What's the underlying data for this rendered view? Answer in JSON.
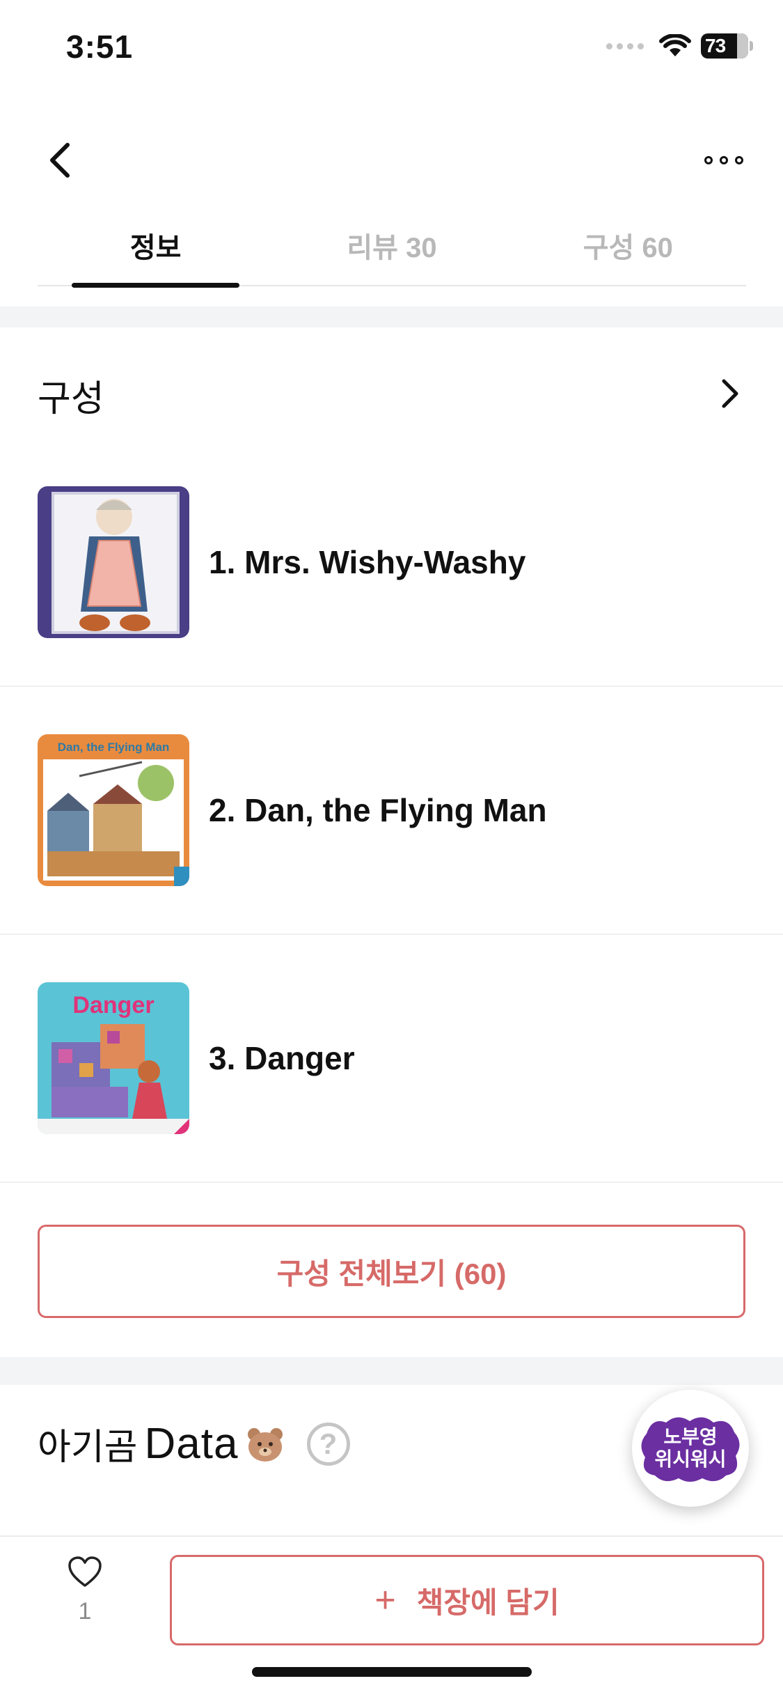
{
  "status_bar": {
    "time": "3:51",
    "battery": "73"
  },
  "nav": {
    "back": "back",
    "more": "more"
  },
  "tabs": [
    {
      "label": "정보",
      "active": true
    },
    {
      "label": "리뷰 30",
      "active": false
    },
    {
      "label": "구성 60",
      "active": false
    }
  ],
  "section": {
    "title": "구성"
  },
  "books": [
    {
      "title": "1. Mrs. Wishy-Washy",
      "cover_text": ""
    },
    {
      "title": "2. Dan, the Flying Man",
      "cover_text": "Dan, the Flying Man"
    },
    {
      "title": "3. Danger",
      "cover_text": "Danger"
    }
  ],
  "view_all_label": "구성 전체보기 (60)",
  "data_section": {
    "title_ko": "아기곰",
    "title_en": "Data",
    "help": "?"
  },
  "badge": {
    "line1": "노부영",
    "line2": "위시워시"
  },
  "bottom": {
    "like_count": "1",
    "add_label": "책장에 담기",
    "add_icon": "+"
  },
  "colors": {
    "accent": "#d8696a",
    "divider": "#f3f4f6"
  }
}
